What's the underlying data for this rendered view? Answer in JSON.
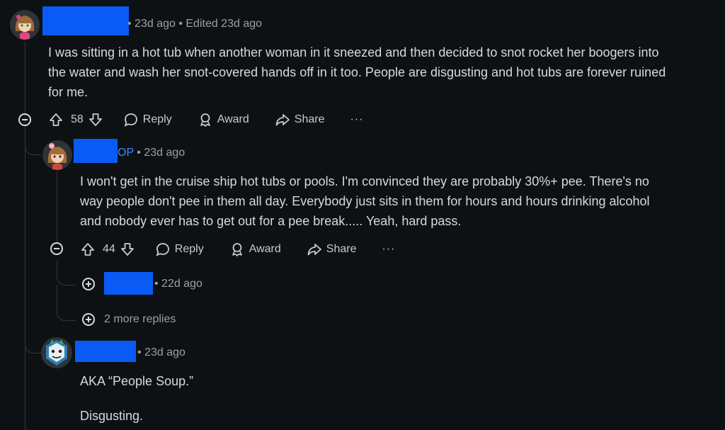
{
  "comment1": {
    "meta": "• 23d ago • Edited 23d ago",
    "body_line1": "I was sitting in a hot tub when another woman in it sneezed and then decided to snot rocket her boogers into",
    "body_line2": "the water and wash her snot-covered hands off in it too. People are disgusting and hot tubs are forever ruined",
    "body_line3": "for me.",
    "votes": "58",
    "reply": "Reply",
    "award": "Award",
    "share": "Share",
    "more": "···"
  },
  "comment2": {
    "op_badge": "OP",
    "meta": "• 23d ago",
    "body_line1": "I won't get in the cruise ship hot tubs or pools. I'm convinced they are probably 30%+ pee. There's no",
    "body_line2": "way people don't pee in them all day. Everybody just sits in them for hours and hours drinking alcohol",
    "body_line3": "and nobody ever has to get out for a pee break..... Yeah, hard pass.",
    "votes": "44",
    "reply": "Reply",
    "award": "Award",
    "share": "Share",
    "more": "···"
  },
  "collapsed_reply": {
    "meta": "• 22d ago"
  },
  "more_replies": "2 more replies",
  "comment3": {
    "meta": "• 23d ago",
    "body_line1": "AKA “People Soup.”",
    "body_line2": "Disgusting."
  },
  "colors": {
    "background": "#0e1114",
    "text": "#d7dadc",
    "meta": "#9aa0a6",
    "op": "#3d8bfd",
    "redaction": "#0a5bf5",
    "thread_line": "#343536"
  }
}
